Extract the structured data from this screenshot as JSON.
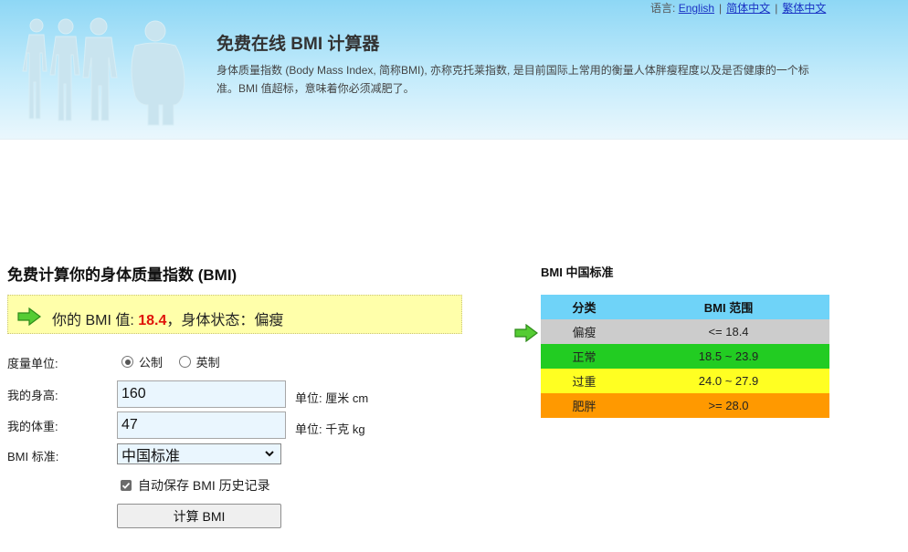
{
  "header": {
    "lang_label": "语言:",
    "languages": [
      "English",
      "简体中文",
      "繁体中文"
    ],
    "title": "免费在线 BMI 计算器",
    "description": "身体质量指数 (Body Mass Index, 简称BMI), 亦称克托莱指数, 是目前国际上常用的衡量人体胖瘦程度以及是否健康的一个标准。BMI 值超标，意味着你必须减肥了。"
  },
  "calculator": {
    "title": "免费计算你的身体质量指数 (BMI)",
    "result": {
      "prefix": "你的 BMI 值: ",
      "value": "18.4",
      "middle": "，身体状态：",
      "status": "偏瘦"
    },
    "unit_system": {
      "label": "度量单位:",
      "options": [
        "公制",
        "英制"
      ],
      "selected": "公制"
    },
    "height": {
      "label": "我的身高:",
      "value": "160",
      "unit": "单位: 厘米 cm"
    },
    "weight": {
      "label": "我的体重:",
      "value": "47",
      "unit": "单位: 千克 kg"
    },
    "standard": {
      "label": "BMI 标准:",
      "selected": "中国标准"
    },
    "save_history": {
      "label": "自动保存 BMI 历史记录",
      "checked": true
    },
    "button_label": "计算 BMI"
  },
  "standard_table": {
    "title": "BMI 中国标准",
    "headers": [
      "分类",
      "BMI 范围"
    ],
    "rows": [
      {
        "category": "偏瘦",
        "range": "<= 18.4",
        "color": "#cccccc"
      },
      {
        "category": "正常",
        "range": "18.5 ~ 23.9",
        "color": "#22cc22"
      },
      {
        "category": "过重",
        "range": "24.0 ~ 27.9",
        "color": "#ffff22"
      },
      {
        "category": "肥胖",
        "range": ">= 28.0",
        "color": "#ff9900"
      }
    ],
    "current_row_index": 0
  },
  "icons": {
    "result_indicator": "green-arrow-icon",
    "table_indicator": "green-arrow-icon"
  }
}
